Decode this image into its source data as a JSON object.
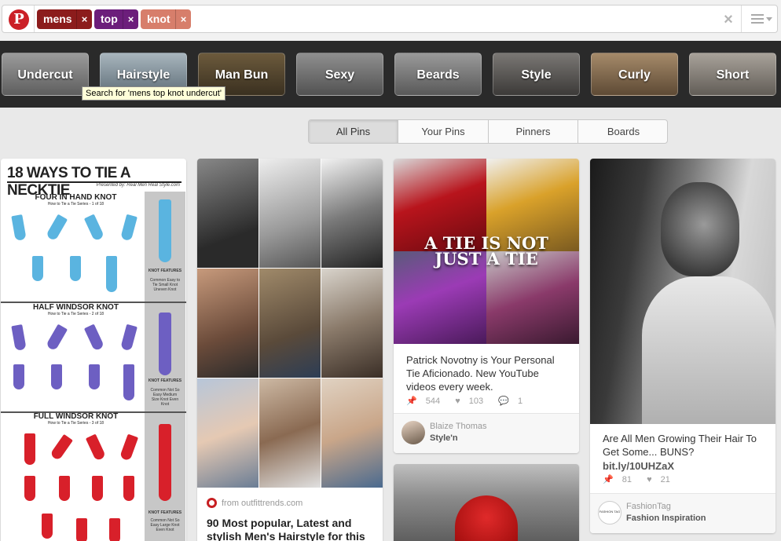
{
  "search": {
    "tokens": [
      {
        "label": "mens",
        "color": "#8c1c1c"
      },
      {
        "label": "top",
        "color": "#6c1e7b"
      },
      {
        "label": "knot",
        "color": "#d77e6b"
      }
    ],
    "remove_glyph": "×"
  },
  "guided": {
    "categories": [
      "Undercut",
      "Hairstyle",
      "Man Bun",
      "Sexy",
      "Beards",
      "Style",
      "Curly",
      "Short"
    ],
    "tooltip": "Search for 'mens top knot undercut'"
  },
  "filters": {
    "tabs": [
      "All Pins",
      "Your Pins",
      "Pinners",
      "Boards"
    ],
    "active": "All Pins"
  },
  "pins": {
    "necktie": {
      "title": "18 WAYS TO TIE A NECKTIE",
      "subtitle": "Presented by: Real Men Real Style.com",
      "knots": [
        {
          "name": "FOUR IN HAND KNOT",
          "series": "How to Tie a Tie Series - 1 of 18",
          "features_head": "KNOT FEATURES",
          "features": "Common Easy to Tie Small Knot Uneven Knot",
          "color": "#5ab4e0"
        },
        {
          "name": "HALF WINDSOR KNOT",
          "series": "How to Tie a Tie Series - 2 of 18",
          "features_head": "KNOT FEATURES",
          "features": "Common Not So Easy Medium Size Knot Even Knot",
          "color": "#6d5fc2"
        },
        {
          "name": "FULL WINDSOR KNOT",
          "series": "How to Tie a Tie Series - 3 of 18",
          "features_head": "KNOT FEATURES",
          "features": "Common Not So Easy Large Knot Even Knot",
          "color": "#d8202a"
        }
      ]
    },
    "hairstyles": {
      "source": "from outfittrends.com",
      "title": "90 Most popular, Latest and stylish Men's Hairstyle for this"
    },
    "tie": {
      "overlay_line1": "A TIE IS NOT",
      "overlay_line2": "JUST A TIE",
      "description": "Patrick Novotny is Your Personal Tie Aficionado. New YouTube videos every week.",
      "repins": "544",
      "likes": "103",
      "comments": "1",
      "pinner": "Blaize Thomas",
      "board": "Style'n"
    },
    "manbun": {
      "description": "Are All Men Growing Their Hair To Get Some... BUNS?",
      "link": "bit.ly/10UHZaX",
      "repins": "81",
      "likes": "21",
      "pinner": "FashionTag",
      "board": "Fashion Inspiration",
      "avatar_text": "FASHION TAG"
    }
  },
  "icons": {
    "repin": "📌",
    "like": "♥",
    "comment": "💬"
  }
}
